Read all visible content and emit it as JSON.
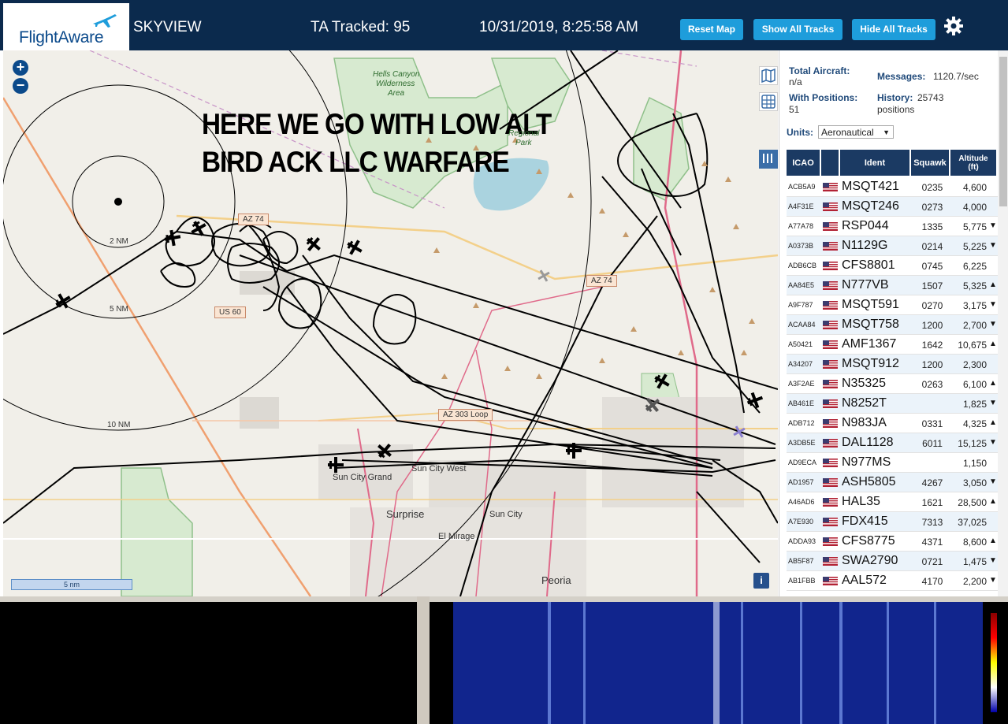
{
  "header": {
    "logo_text": "FlightAware",
    "app_title": "SKYVIEW",
    "ta_tracked": "TA Tracked: 95",
    "datetime": "10/31/2019, 8:25:58 AM",
    "buttons": {
      "reset_map": "Reset Map",
      "show_all_tracks": "Show All Tracks",
      "hide_all_tracks": "Hide All Tracks"
    },
    "settings_icon": "gear-icon"
  },
  "map": {
    "overlay_text_line1": "HERE WE GO WITH LOW ALT",
    "overlay_text_line2": "BIRD ACK LLC WARFARE",
    "range_rings": [
      "2 NM",
      "5 NM",
      "10 NM"
    ],
    "places": [
      "Hells Canyon",
      "Wilderness",
      "Area",
      "Regional",
      "Park",
      "Sun City Grand",
      "Sun City West",
      "Surprise",
      "Sun City",
      "El Mirage",
      "Peoria"
    ],
    "roads": [
      "AZ 74",
      "AZ 74",
      "US 60",
      "AZ 303 Loop"
    ],
    "scale": "5 nm",
    "zoom_in": "+",
    "zoom_out": "−",
    "info": "i"
  },
  "panel": {
    "total_aircraft_label": "Total Aircraft:",
    "total_aircraft_value": "n/a",
    "with_positions_label": "With Positions:",
    "with_positions_value": "51",
    "messages_label": "Messages:",
    "messages_value": "1120.7/sec",
    "history_label": "History:",
    "history_value": "25743",
    "history_unit": "positions",
    "units_label": "Units:",
    "units_value": "Aeronautical",
    "columns": {
      "icao": "ICAO",
      "ident": "Ident",
      "squawk": "Squawk",
      "altitude": "Altitude",
      "altitude_unit": "(ft)"
    },
    "rows": [
      {
        "icao": "ACB5A9",
        "ident": "MSQT421",
        "squawk": "0235",
        "alt": "4,600",
        "trend": ""
      },
      {
        "icao": "A4F31E",
        "ident": "MSQT246",
        "squawk": "0273",
        "alt": "4,000",
        "trend": ""
      },
      {
        "icao": "A77A78",
        "ident": "RSP044",
        "squawk": "1335",
        "alt": "5,775",
        "trend": "▼"
      },
      {
        "icao": "A0373B",
        "ident": "N1129G",
        "squawk": "0214",
        "alt": "5,225",
        "trend": "▼"
      },
      {
        "icao": "ADB6CB",
        "ident": "CFS8801",
        "squawk": "0745",
        "alt": "6,225",
        "trend": ""
      },
      {
        "icao": "AA84E5",
        "ident": "N777VB",
        "squawk": "1507",
        "alt": "5,325",
        "trend": "▲"
      },
      {
        "icao": "A9F787",
        "ident": "MSQT591",
        "squawk": "0270",
        "alt": "3,175",
        "trend": "▼"
      },
      {
        "icao": "ACAA84",
        "ident": "MSQT758",
        "squawk": "1200",
        "alt": "2,700",
        "trend": "▼"
      },
      {
        "icao": "A50421",
        "ident": "AMF1367",
        "squawk": "1642",
        "alt": "10,675",
        "trend": "▲"
      },
      {
        "icao": "A34207",
        "ident": "MSQT912",
        "squawk": "1200",
        "alt": "2,300",
        "trend": ""
      },
      {
        "icao": "A3F2AE",
        "ident": "N35325",
        "squawk": "0263",
        "alt": "6,100",
        "trend": "▲"
      },
      {
        "icao": "AB461E",
        "ident": "N8252T",
        "squawk": "",
        "alt": "1,825",
        "trend": "▼"
      },
      {
        "icao": "ADB712",
        "ident": "N983JA",
        "squawk": "0331",
        "alt": "4,325",
        "trend": "▲"
      },
      {
        "icao": "A3DB5E",
        "ident": "DAL1128",
        "squawk": "6011",
        "alt": "15,125",
        "trend": "▼"
      },
      {
        "icao": "AD9ECA",
        "ident": "N977MS",
        "squawk": "",
        "alt": "1,150",
        "trend": ""
      },
      {
        "icao": "AD1957",
        "ident": "ASH5805",
        "squawk": "4267",
        "alt": "3,050",
        "trend": "▼"
      },
      {
        "icao": "A46AD6",
        "ident": "HAL35",
        "squawk": "1621",
        "alt": "28,500",
        "trend": "▲"
      },
      {
        "icao": "A7E930",
        "ident": "FDX415",
        "squawk": "7313",
        "alt": "37,025",
        "trend": ""
      },
      {
        "icao": "ADDA93",
        "ident": "CFS8775",
        "squawk": "4371",
        "alt": "8,600",
        "trend": "▲"
      },
      {
        "icao": "AB5F87",
        "ident": "SWA2790",
        "squawk": "0721",
        "alt": "1,475",
        "trend": "▼"
      },
      {
        "icao": "AB1FBB",
        "ident": "AAL572",
        "squawk": "4170",
        "alt": "2,200",
        "trend": "▼"
      }
    ]
  },
  "colors": {
    "header_bg": "#0b2a4d",
    "button_blue": "#1e9ddb",
    "table_header": "#1b3a63"
  }
}
